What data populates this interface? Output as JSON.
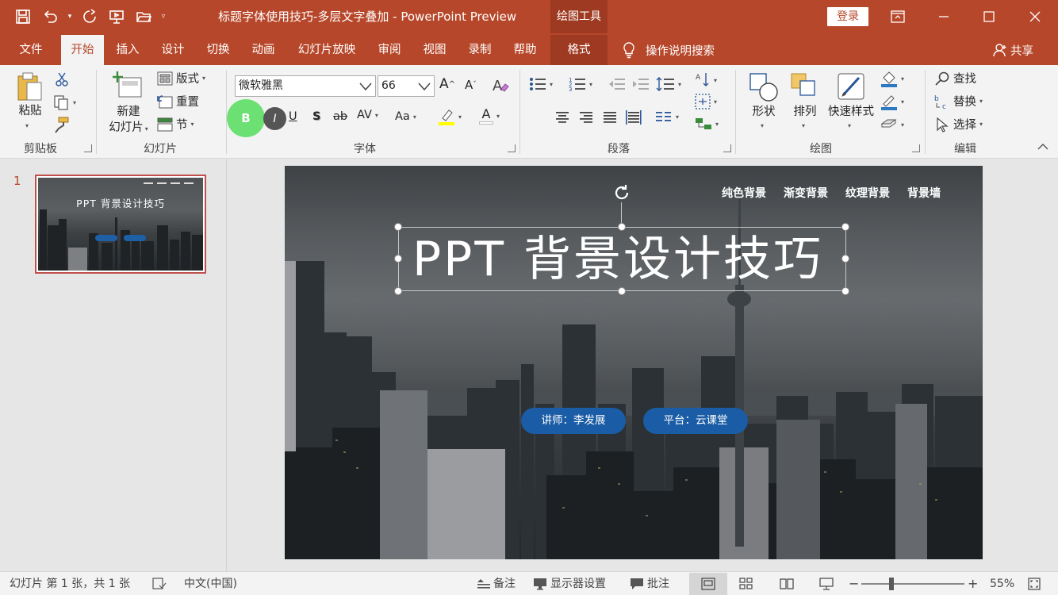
{
  "window": {
    "title": "标题字体使用技巧-多层文字叠加  -  PowerPoint Preview",
    "context_group": "绘图工具",
    "login_label": "登录"
  },
  "tabs": [
    "文件",
    "开始",
    "插入",
    "设计",
    "切换",
    "动画",
    "幻灯片放映",
    "审阅",
    "视图",
    "录制",
    "帮助",
    "格式"
  ],
  "active_tab": "开始",
  "tell_me": "操作说明搜索",
  "share": "共享",
  "ribbon": {
    "clipboard": {
      "label": "剪贴板",
      "paste": "粘贴"
    },
    "slides": {
      "label": "幻灯片",
      "new_slide_1": "新建",
      "new_slide_2": "幻灯片",
      "layout": "版式",
      "reset": "重置",
      "section": "节"
    },
    "font": {
      "label": "字体",
      "font_name": "微软雅黑",
      "font_size": "66",
      "bold": "B",
      "italic": "I",
      "underline": "U",
      "shadow": "S",
      "strike": "ab",
      "spacing": "AV",
      "case": "Aa",
      "font_color": "A"
    },
    "paragraph": {
      "label": "段落"
    },
    "drawing": {
      "label": "绘图",
      "shapes": "形状",
      "arrange": "排列",
      "quick_styles": "快速样式"
    },
    "editing": {
      "label": "编辑",
      "find": "查找",
      "replace": "替换",
      "select": "选择"
    }
  },
  "thumbnail": {
    "number": "1",
    "title": "PPT 背景设计技巧"
  },
  "slide": {
    "title": "PPT 背景设计技巧",
    "nav": [
      "纯色背景",
      "渐变背景",
      "纹理背景",
      "背景墙"
    ],
    "presenter": "讲师：李发展",
    "platform": "平台：云课堂"
  },
  "status": {
    "slide_info": "幻灯片 第 1 张，共 1 张",
    "language": "中文(中国)",
    "notes": "备注",
    "display_settings": "显示器设置",
    "comments": "批注",
    "zoom": "55%"
  },
  "colors": {
    "accent": "#b7472a",
    "pill": "#1a5ca5",
    "bold_highlight": "#6ce073"
  }
}
